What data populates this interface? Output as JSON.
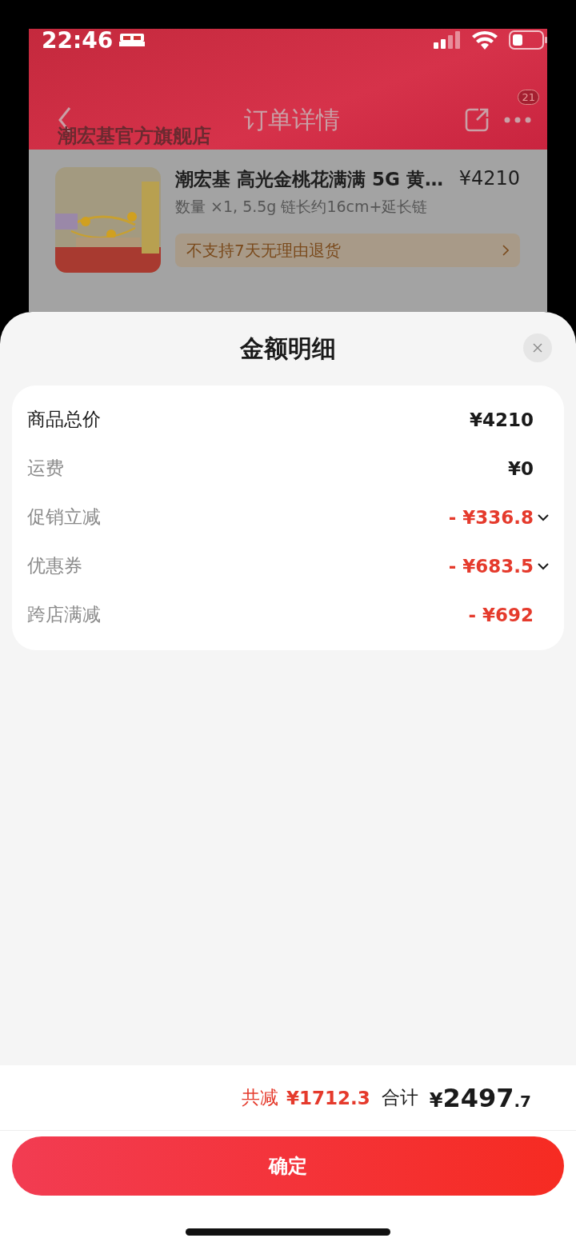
{
  "status_bar": {
    "time": "22:46"
  },
  "background_page": {
    "nav_title": "订单详情",
    "message_count": "21",
    "store_name": "潮宏基官方旗舰店",
    "product": {
      "name": "潮宏基  高光金桃花满满 5G 黄…",
      "price": "¥4210",
      "spec": "数量 ×1, 5.5g 链长约16cm+延长链",
      "return_notice": "不支持7天无理由退货"
    }
  },
  "sheet": {
    "title": "金额明细",
    "rows": [
      {
        "label": "商品总价",
        "value": "¥4210",
        "kind": "total",
        "expandable": false
      },
      {
        "label": "运费",
        "value": "¥0",
        "kind": "fee",
        "expandable": false
      },
      {
        "label": "促销立减",
        "value": "- ¥336.8",
        "kind": "discount",
        "expandable": true
      },
      {
        "label": "优惠券",
        "value": "- ¥683.5",
        "kind": "discount",
        "expandable": true
      },
      {
        "label": "跨店满减",
        "value": "- ¥692",
        "kind": "discount",
        "expandable": false
      }
    ],
    "summary": {
      "discount_label": "共减",
      "discount_value": "¥1712.3",
      "total_label": "合计",
      "total_currency": "¥",
      "total_integer": "2497",
      "total_decimal": ".7"
    },
    "confirm_button": "确定"
  }
}
